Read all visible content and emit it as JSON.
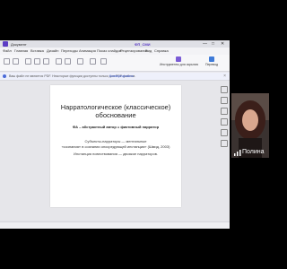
{
  "window": {
    "tabs": [
      "Документ",
      "ФП_СМИ"
    ],
    "controls": [
      "—",
      "□",
      "✕"
    ]
  },
  "menu": {
    "items": [
      "Файл",
      "Главная",
      "Вставка",
      "Дизайн",
      "Переходы",
      "Анимация",
      "Показ слайдов",
      "Рецензирование",
      "Вид",
      "Справка"
    ]
  },
  "ribbon": {
    "buttons": [
      "Инструменты для скрытия",
      "Перевод"
    ]
  },
  "notice": {
    "text": "Ваш файл не является PDF. Некоторые функции доступны только для PDF-файлов.",
    "link": "Конвертировать"
  },
  "slide": {
    "title": "Нарратологическое (классическое) обоснование",
    "subtitle": "ФА – абстрактный автор = фиктивный нарратор",
    "lines": [
      "Субъекты-нарраторы — ментальные",
      "«сознания» в сознании опосредующей инстанции» (Шмид, 2003)",
      "Инстанция повествования — двоякое нарраторов."
    ]
  },
  "video": {
    "participant_name": "Полина"
  }
}
